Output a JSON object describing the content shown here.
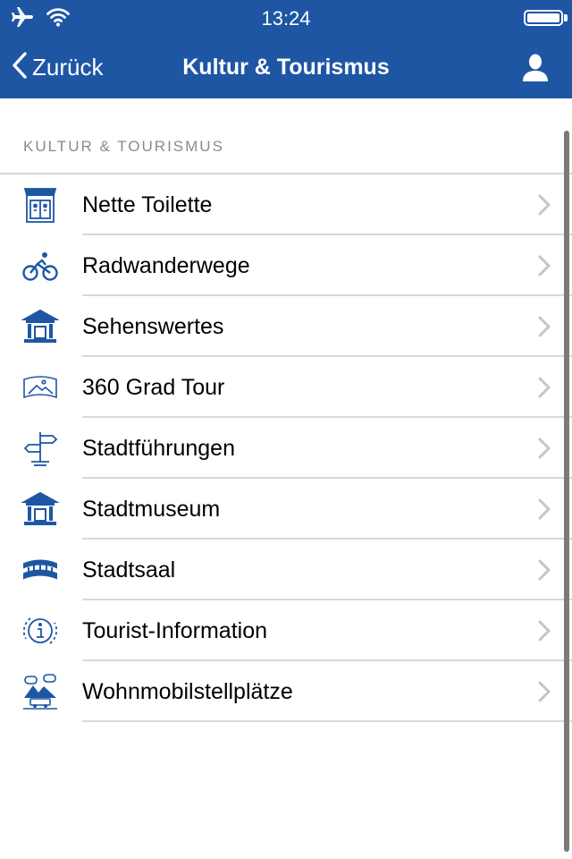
{
  "status_bar": {
    "time": "13:24",
    "icons": [
      "airplane-icon",
      "wifi-icon",
      "battery-icon"
    ]
  },
  "nav": {
    "back_label": "Zurück",
    "title": "Kultur & Tourismus",
    "profile_icon": "user-icon"
  },
  "section": {
    "header": "KULTUR & TOURISMUS",
    "items": [
      {
        "label": "Nette Toilette",
        "icon": "toilet-building-icon"
      },
      {
        "label": "Radwanderwege",
        "icon": "bicycle-icon"
      },
      {
        "label": "Sehenswertes",
        "icon": "museum-building-icon"
      },
      {
        "label": "360 Grad Tour",
        "icon": "panorama-360-icon"
      },
      {
        "label": "Stadtführungen",
        "icon": "signpost-icon"
      },
      {
        "label": "Stadtmuseum",
        "icon": "museum-building-icon"
      },
      {
        "label": "Stadtsaal",
        "icon": "bridge-hall-icon"
      },
      {
        "label": "Tourist-Information",
        "icon": "info-circle-icon"
      },
      {
        "label": "Wohnmobilstellplätze",
        "icon": "camper-mountain-icon"
      }
    ]
  },
  "colors": {
    "brand_blue": "#1e56a4",
    "separator": "#d8d8dc",
    "section_header": "#8a8a8f",
    "chevron": "#c4c4c9"
  }
}
